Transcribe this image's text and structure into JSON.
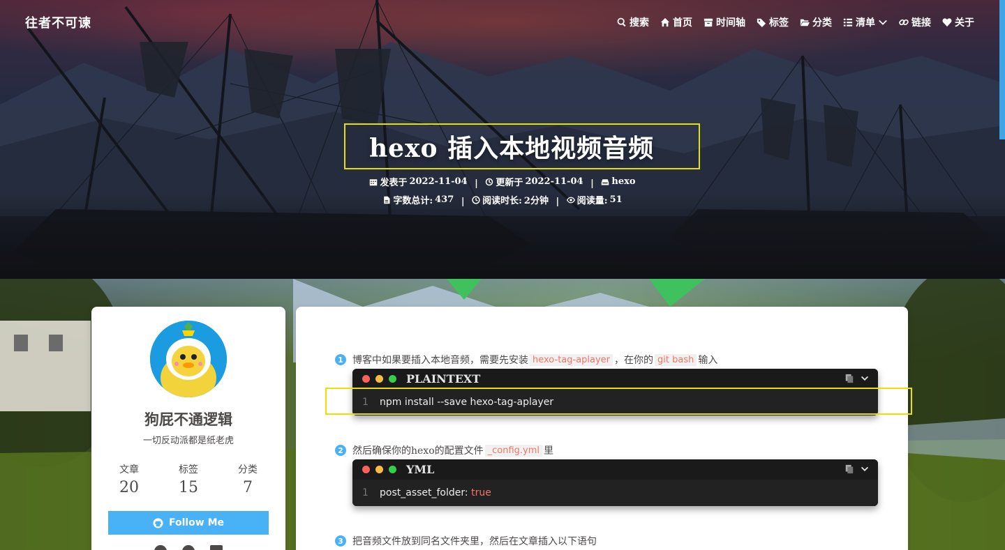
{
  "nav": {
    "brand": "往者不可谏",
    "items": [
      {
        "label": "搜索",
        "icon": "search-icon"
      },
      {
        "label": "首页",
        "icon": "home-icon"
      },
      {
        "label": "时间轴",
        "icon": "archive-icon"
      },
      {
        "label": "标签",
        "icon": "tags-icon"
      },
      {
        "label": "分类",
        "icon": "folder-icon"
      },
      {
        "label": "清单",
        "icon": "list-icon"
      },
      {
        "label": "链接",
        "icon": "link-icon"
      },
      {
        "label": "关于",
        "icon": "heart-icon"
      }
    ]
  },
  "post": {
    "title": "hexo 插入本地视频音频",
    "posted_label": "发表于",
    "posted_date": "2022-11-04",
    "updated_label": "更新于",
    "updated_date": "2022-11-04",
    "category": "hexo",
    "wordcount_label": "字数总计:",
    "wordcount": "437",
    "readtime_label": "阅读时长:",
    "readtime": "2分钟",
    "views_label": "阅读量:",
    "views": "51"
  },
  "sidebar": {
    "author": "狗屁不通逻辑",
    "slogan": "一切反动派都是纸老虎",
    "stats": [
      {
        "label": "文章",
        "value": "20"
      },
      {
        "label": "标签",
        "value": "15"
      },
      {
        "label": "分类",
        "value": "7"
      }
    ],
    "follow_label": "Follow Me"
  },
  "content": {
    "step1": {
      "num": "1",
      "text_a": "博客中如果要插入本地音频，需要先安装",
      "code_a": "hexo-tag-aplayer",
      "text_b": "，在你的",
      "code_b": "git bash",
      "text_c": "输入"
    },
    "block1": {
      "lang": "PLAINTEXT",
      "line": "1",
      "code": "npm install --save hexo-tag-aplayer"
    },
    "step2": {
      "num": "2",
      "text_a": "然后确保你的hexo的配置文件",
      "code_a": "_config.yml",
      "text_b": "里"
    },
    "block2": {
      "lang": "YML",
      "line": "1",
      "key": "post_asset_folder:",
      "value": "true"
    },
    "step3": {
      "num": "3",
      "text_a": "把音频文件放到同名文件夹里，然后在文章插入以下语句"
    }
  },
  "colors": {
    "accent": "#49b1f5",
    "inline_code": "#f47466",
    "highlight_box": "#e8e000"
  }
}
